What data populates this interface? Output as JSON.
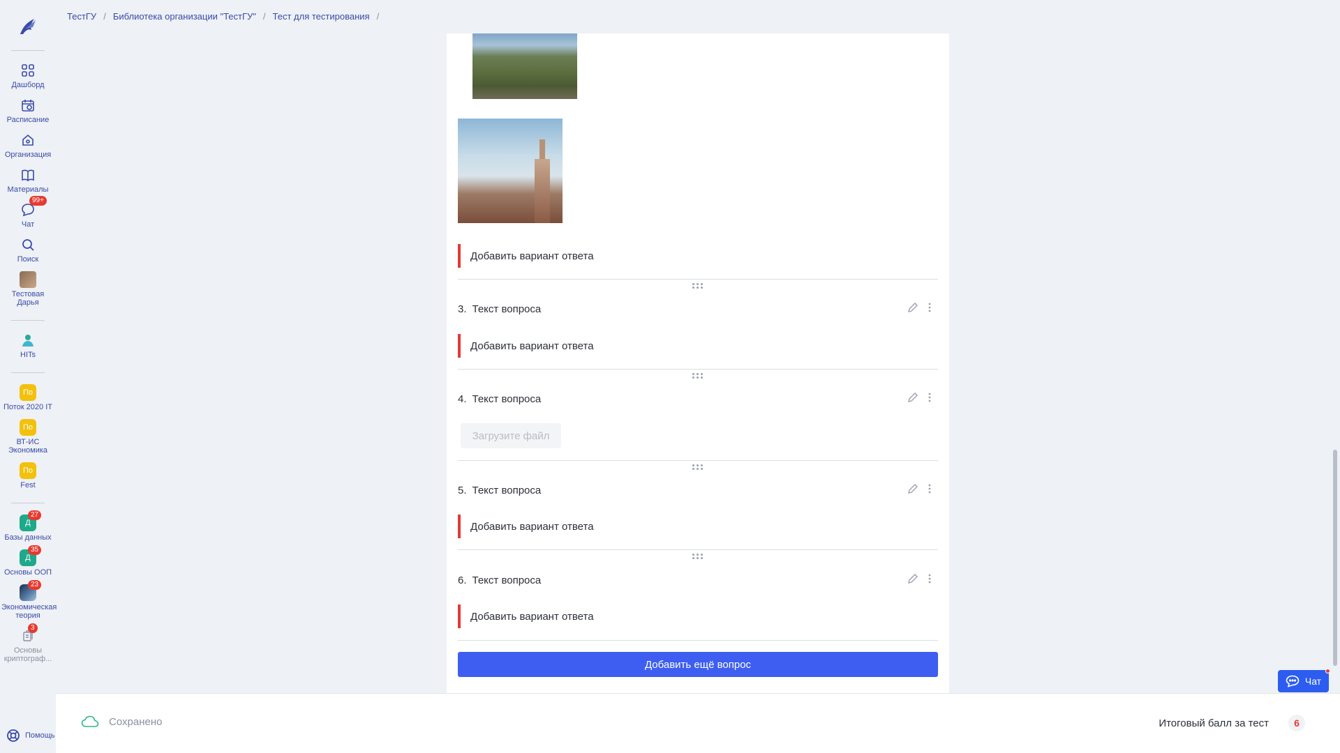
{
  "breadcrumbs": [
    "ТестГУ",
    "Библиотека организации \"ТестГУ\"",
    "Тест для тестирования"
  ],
  "breadcrumb_separator": "/",
  "sidebar": {
    "items": [
      {
        "label": "Дашборд",
        "icon": "grid-icon"
      },
      {
        "label": "Расписание",
        "icon": "calendar-icon"
      },
      {
        "label": "Организация",
        "icon": "home-icon"
      },
      {
        "label": "Материалы",
        "icon": "book-icon"
      },
      {
        "label": "Чат",
        "icon": "chat-icon",
        "badge": "99+"
      },
      {
        "label": "Поиск",
        "icon": "search-icon"
      },
      {
        "label": "Тестовая Дарья",
        "icon": "avatar"
      },
      {
        "label": "HITs",
        "icon": "hits-icon"
      },
      {
        "label": "Поток 2020 IT",
        "tile": "По"
      },
      {
        "label": "ВТ-ИС Экономика",
        "tile": "По"
      },
      {
        "label": "Fest",
        "tile": "По"
      },
      {
        "label": "Базы данных",
        "tile": "Д",
        "badge": "27"
      },
      {
        "label": "Основы ООП",
        "tile": "Д",
        "badge": "35"
      },
      {
        "label": "Экономическая теория",
        "badge": "23"
      },
      {
        "label": "Основы криптограф...",
        "badge": "3"
      }
    ],
    "help_label": "Помощь"
  },
  "questions": [
    {
      "number": "3.",
      "title": "Текст вопроса",
      "action": "Добавить вариант ответа"
    },
    {
      "number": "4.",
      "title": "Текст вопроса",
      "action": "Загрузите файл"
    },
    {
      "number": "5.",
      "title": "Текст вопроса",
      "action": "Добавить вариант ответа"
    },
    {
      "number": "6.",
      "title": "Текст вопроса",
      "action": "Добавить вариант ответа"
    }
  ],
  "top_add_answer": "Добавить вариант ответа",
  "add_question_label": "Добавить ещё вопрос",
  "bottom": {
    "saved_label": "Сохранено",
    "score_label": "Итоговый балл за тест",
    "score_value": "6"
  },
  "chat_button_label": "Чат",
  "colors": {
    "accent": "#3d5ef0",
    "danger": "#e53935",
    "tile_yellow": "#f3c10c",
    "tile_green": "#1ea98a"
  }
}
